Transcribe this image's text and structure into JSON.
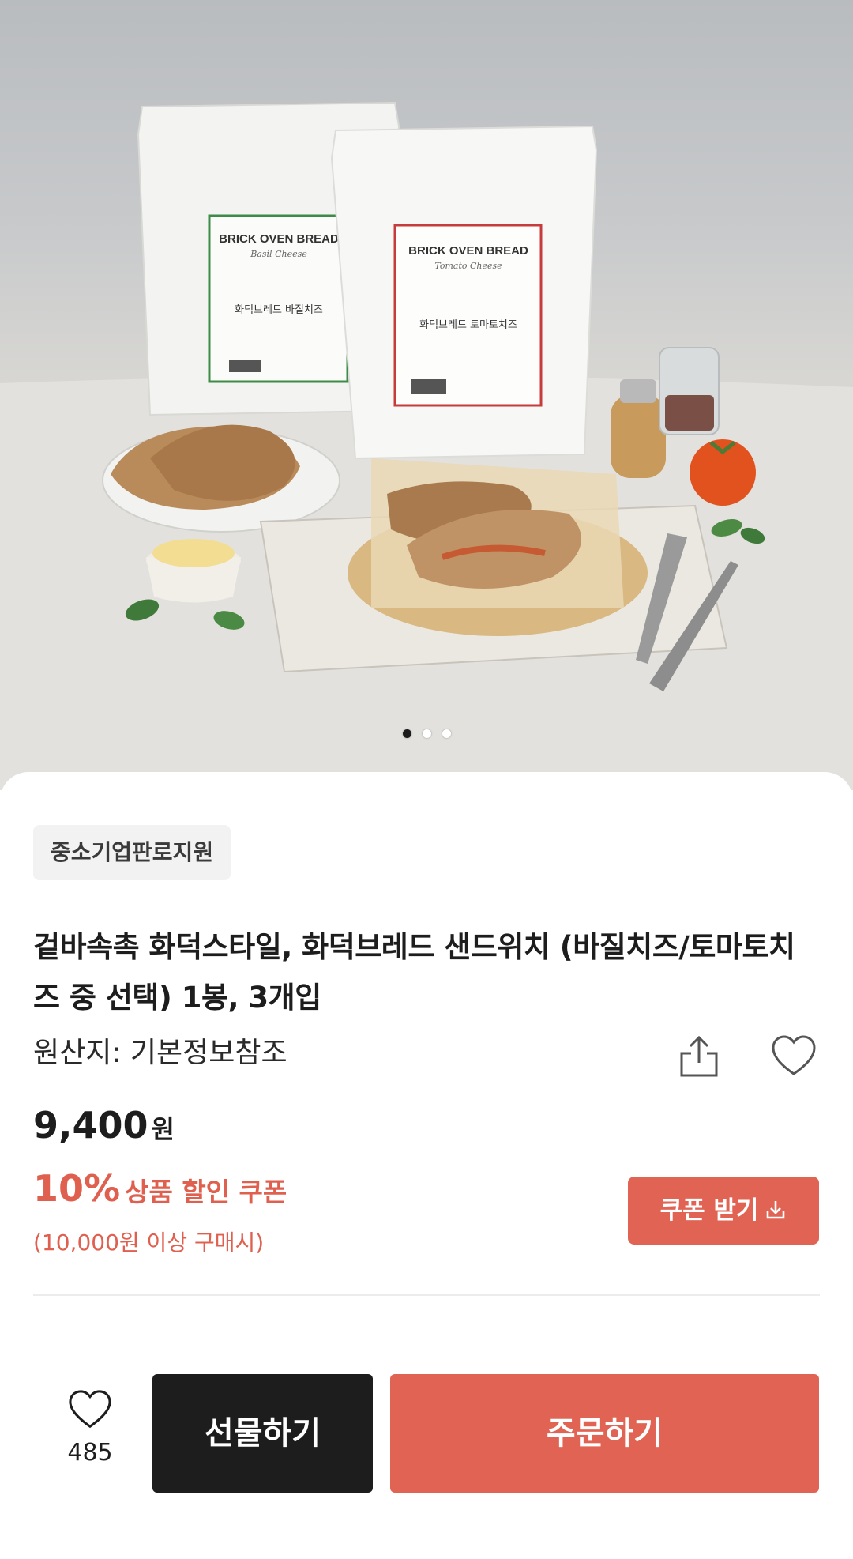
{
  "hero": {
    "packages": [
      {
        "brand": "BRICK OVEN BREAD",
        "flavor": "Basil Cheese",
        "name_kr": "화덕브레드 바질치즈"
      },
      {
        "brand": "BRICK OVEN BREAD",
        "flavor": "Tomato Cheese",
        "name_kr": "화덕브레드 토마토치즈"
      }
    ],
    "carousel": {
      "count": 3,
      "active": 1
    }
  },
  "product": {
    "badge": "중소기업판로지원",
    "title": "겉바속촉 화덕스타일, 화덕브레드 샌드위치 (바질치즈/토마토치즈 중 선택) 1봉, 3개입",
    "origin": "원산지: 기본정보참조",
    "price": "9,400",
    "price_unit": "원"
  },
  "coupon": {
    "rate": "10%",
    "text": "상품 할인 쿠폰",
    "condition": "(10,000원 이상 구매시)",
    "button_label": "쿠폰 받기"
  },
  "bottom_bar": {
    "wish_count": "485",
    "gift_label": "선물하기",
    "order_label": "주문하기"
  },
  "colors": {
    "accent": "#e06353",
    "dark_button": "#1d1d1d"
  }
}
